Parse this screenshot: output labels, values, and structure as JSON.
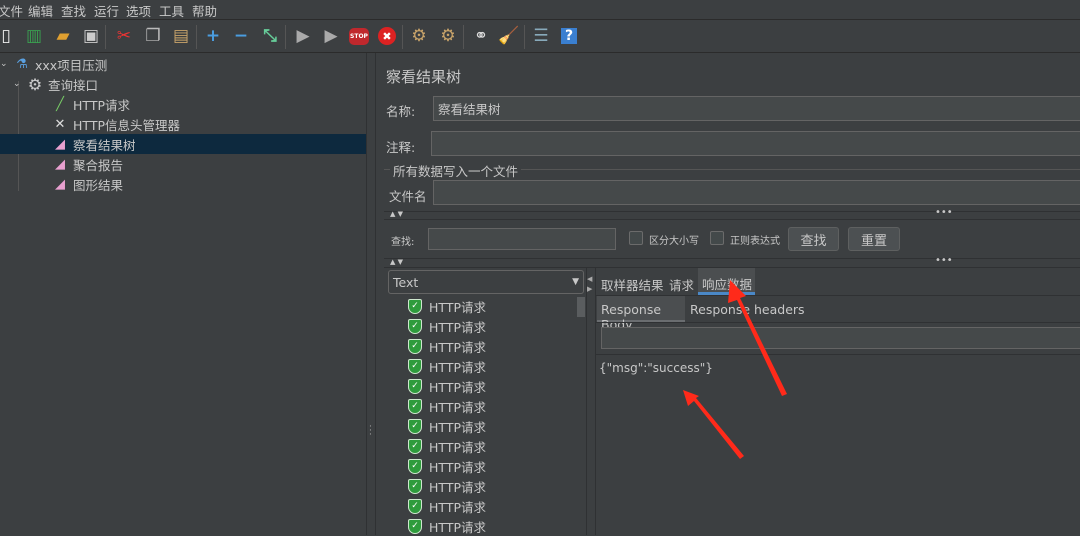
{
  "menu": [
    "文件",
    "编辑",
    "查找",
    "运行",
    "选项",
    "工具",
    "帮助"
  ],
  "toolbar": [
    "new-icon",
    "templates-icon",
    "open-icon",
    "save-icon",
    "cut-icon",
    "copy-icon",
    "paste-icon",
    "expand-icon",
    "collapse-icon",
    "toggle-icon",
    "start-icon",
    "start-no-pause-icon",
    "stop-icon",
    "shutdown-icon",
    "clear-icon",
    "clear-all-icon",
    "search-icon",
    "reset-search-icon",
    "function-helper-icon",
    "help-icon"
  ],
  "tree": [
    {
      "label": "xxx项目压测",
      "icon": "test-plan-icon"
    },
    {
      "label": "查询接口",
      "icon": "thread-group-icon"
    },
    {
      "label": "HTTP请求",
      "icon": "sampler-icon"
    },
    {
      "label": "HTTP信息头管理器",
      "icon": "config-icon"
    },
    {
      "label": "察看结果树",
      "icon": "listener-icon",
      "selected": true
    },
    {
      "label": "聚合报告",
      "icon": "listener-icon"
    },
    {
      "label": "图形结果",
      "icon": "listener-icon"
    }
  ],
  "panel": {
    "title": "察看结果树",
    "name_label": "名称:",
    "name_value": "察看结果树",
    "comment_label": "注释:",
    "comment_value": "",
    "file_group": "所有数据写入一个文件",
    "filename_label": "文件名",
    "filename_value": "",
    "search_label": "查找:",
    "search_value": "",
    "case_label": "区分大小写",
    "regex_label": "正则表达式",
    "find_btn": "查找",
    "reset_btn": "重置",
    "renderer": "Text",
    "results": [
      "HTTP请求",
      "HTTP请求",
      "HTTP请求",
      "HTTP请求",
      "HTTP请求",
      "HTTP请求",
      "HTTP请求",
      "HTTP请求",
      "HTTP请求",
      "HTTP请求",
      "HTTP请求",
      "HTTP请求"
    ],
    "tabs": [
      "取样器结果",
      "请求",
      "响应数据"
    ],
    "active_tab": "响应数据",
    "subtabs": [
      "Response Body",
      "Response headers"
    ],
    "active_subtab": "Response Body",
    "response_body": "{\"msg\":\"success\"}"
  },
  "colors": {
    "bg": "#3c3f41",
    "selection": "#0d293e",
    "tab_accent": "#4a88c7",
    "annotation": "#ff2a1a"
  }
}
